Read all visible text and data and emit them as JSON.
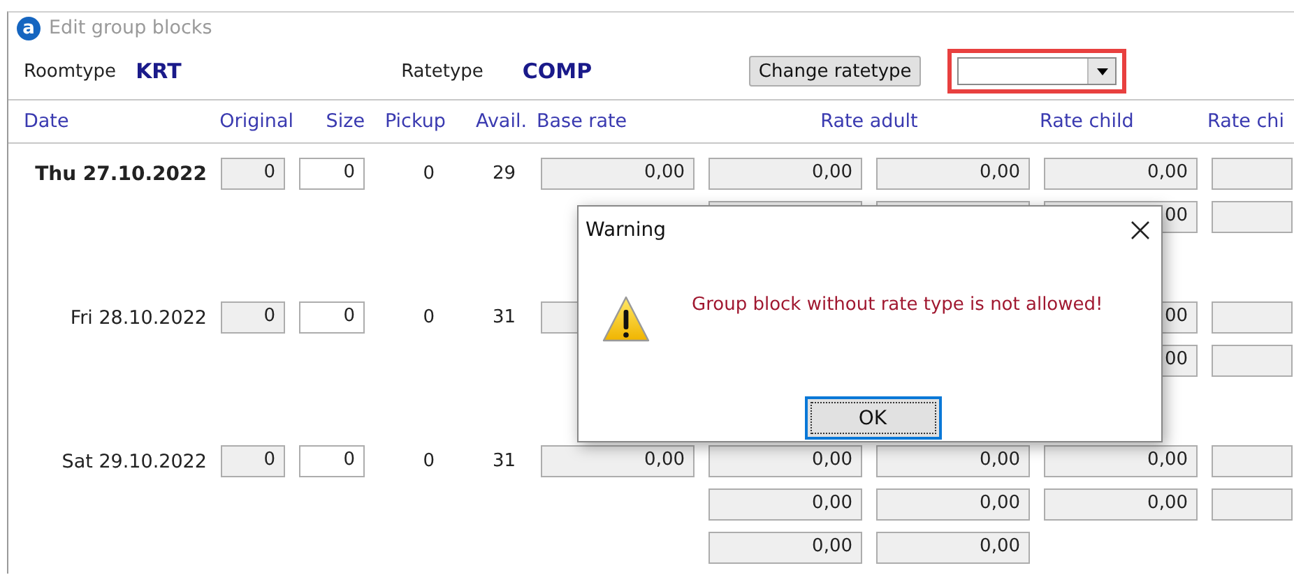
{
  "window": {
    "logo": "a",
    "title": "Edit group blocks"
  },
  "toolbar": {
    "roomtype_label": "Roomtype",
    "roomtype": "KRT",
    "ratetype_label": "Ratetype",
    "ratetype": "COMP",
    "button": "Change ratetype",
    "dropdown": {
      "highlighted": true
    }
  },
  "table": {
    "columns": [
      "Date",
      "Original",
      "Size",
      "Pickup",
      "Avail.",
      "Base rate",
      "Rate adult",
      "Rate child",
      "Rate chi"
    ],
    "rows": [
      {
        "date": "Thu 27.10.2022",
        "selected": true,
        "original": "0",
        "block_size": "0",
        "pickup": "0",
        "avail": "29",
        "lines": [
          [
            {
              "kind": "field",
              "value": "0,00"
            },
            {
              "kind": "field",
              "value": "0,00"
            },
            {
              "kind": "field",
              "value": "0,00"
            },
            {
              "kind": "field",
              "value": "0,00"
            },
            {
              "kind": "empty"
            }
          ],
          [
            {
              "kind": "none"
            },
            {
              "kind": "empty"
            },
            {
              "kind": "empty"
            },
            {
              "kind": "field",
              "value": "00"
            },
            {
              "kind": "empty"
            }
          ]
        ]
      },
      {
        "date": "Fri 28.10.2022",
        "selected": false,
        "original": "0",
        "block_size": "0",
        "pickup": "0",
        "avail": "31",
        "lines": [
          [
            {
              "kind": "empty"
            },
            {
              "kind": "none"
            },
            {
              "kind": "none"
            },
            {
              "kind": "field",
              "value": "00"
            },
            {
              "kind": "empty"
            }
          ],
          [
            {
              "kind": "none"
            },
            {
              "kind": "none"
            },
            {
              "kind": "none"
            },
            {
              "kind": "field",
              "value": "00"
            },
            {
              "kind": "empty"
            }
          ]
        ]
      },
      {
        "date": "Sat 29.10.2022",
        "selected": false,
        "original": "0",
        "block_size": "0",
        "pickup": "0",
        "avail": "31",
        "lines": [
          [
            {
              "kind": "field",
              "value": "0,00"
            },
            {
              "kind": "field",
              "value": "0,00"
            },
            {
              "kind": "field",
              "value": "0,00"
            },
            {
              "kind": "field",
              "value": "0,00"
            },
            {
              "kind": "empty"
            }
          ],
          [
            {
              "kind": "none"
            },
            {
              "kind": "field",
              "value": "0,00"
            },
            {
              "kind": "field",
              "value": "0,00"
            },
            {
              "kind": "field",
              "value": "0,00"
            },
            {
              "kind": "empty"
            }
          ],
          [
            {
              "kind": "none"
            },
            {
              "kind": "field",
              "value": "0,00"
            },
            {
              "kind": "field",
              "value": "0,00"
            }
          ]
        ]
      }
    ]
  },
  "dialog": {
    "title": "Warning",
    "message": "Group block without rate type is not allowed!",
    "button": "OK"
  }
}
